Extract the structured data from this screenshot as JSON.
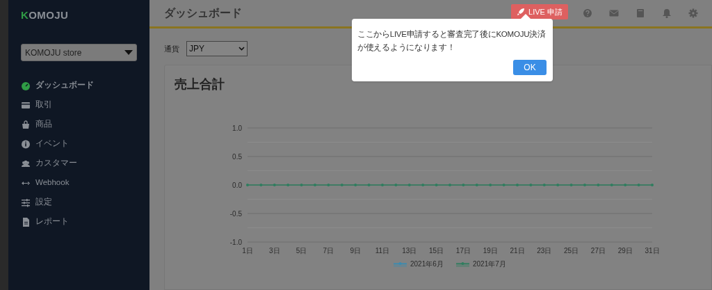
{
  "sidebar": {
    "logo": "KOMOJU",
    "store_select": {
      "value": "KOMOJU store"
    },
    "items": [
      {
        "label": "ダッシュボード",
        "selected": true
      },
      {
        "label": "取引",
        "selected": false
      },
      {
        "label": "商品",
        "selected": false
      },
      {
        "label": "イベント",
        "selected": false
      },
      {
        "label": "カスタマー",
        "selected": false
      },
      {
        "label": "Webhook",
        "selected": false
      },
      {
        "label": "設定",
        "selected": false
      },
      {
        "label": "レポート",
        "selected": false
      }
    ]
  },
  "header": {
    "title": "ダッシュボード",
    "live_button": "LIVE 申請"
  },
  "popover": {
    "message": "ここからLIVE申請すると審査完了後にKOMOJU決済が使えるようになります！",
    "button": "OK"
  },
  "currency": {
    "label": "通貨",
    "value": "JPY"
  },
  "card": {
    "title": "売上合計",
    "chart_data": {
      "type": "line",
      "x": [
        1,
        2,
        3,
        4,
        5,
        6,
        7,
        8,
        9,
        10,
        11,
        12,
        13,
        14,
        15,
        16,
        17,
        18,
        19,
        20,
        21,
        22,
        23,
        24,
        25,
        26,
        27,
        28,
        29,
        30,
        31
      ],
      "xticks": [
        {
          "value": 1,
          "label": "1日"
        },
        {
          "value": 3,
          "label": "3日"
        },
        {
          "value": 5,
          "label": "5日"
        },
        {
          "value": 7,
          "label": "7日"
        },
        {
          "value": 9,
          "label": "9日"
        },
        {
          "value": 11,
          "label": "11日"
        },
        {
          "value": 13,
          "label": "13日"
        },
        {
          "value": 15,
          "label": "15日"
        },
        {
          "value": 17,
          "label": "17日"
        },
        {
          "value": 19,
          "label": "19日"
        },
        {
          "value": 21,
          "label": "21日"
        },
        {
          "value": 23,
          "label": "23日"
        },
        {
          "value": 25,
          "label": "25日"
        },
        {
          "value": 27,
          "label": "27日"
        },
        {
          "value": 29,
          "label": "29日"
        },
        {
          "value": 31,
          "label": "31日"
        }
      ],
      "xlim": [
        1,
        31
      ],
      "ylim": [
        -1,
        1
      ],
      "legend": "bottom",
      "yticks": [
        {
          "value": 1,
          "label": "1.0"
        },
        {
          "value": 0.5,
          "label": "0.5"
        },
        {
          "value": 0,
          "label": "0.0"
        },
        {
          "value": -0.5,
          "label": "-0.5"
        },
        {
          "value": -1,
          "label": "-1.0"
        }
      ],
      "series": [
        {
          "name": "2021年6月",
          "color": "#3b8bb0",
          "values": [
            null,
            null,
            null,
            null,
            null,
            null,
            null,
            null,
            null,
            null,
            null,
            null,
            null,
            null,
            null,
            null,
            null,
            null,
            null,
            null,
            null,
            null,
            null,
            null,
            null,
            null,
            null,
            null,
            null,
            null,
            null
          ]
        },
        {
          "name": "2021年7月",
          "color": "#2e7d5e",
          "values": [
            0,
            0,
            0,
            0,
            0,
            0,
            0,
            0,
            0,
            0,
            0,
            0,
            0,
            0,
            0,
            0,
            0,
            0,
            0,
            0,
            0,
            0,
            0,
            0,
            0,
            0,
            0,
            0,
            0,
            0,
            0
          ]
        }
      ]
    }
  }
}
